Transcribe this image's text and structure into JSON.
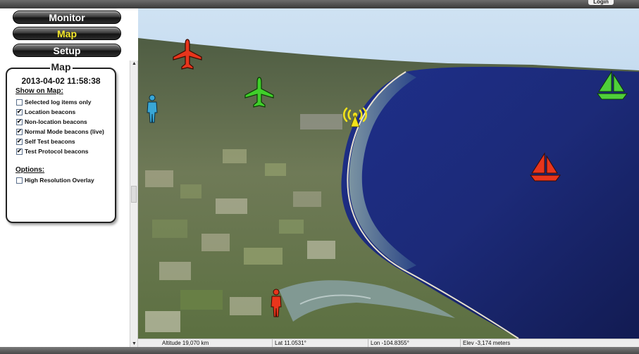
{
  "header": {
    "login_label": "Login"
  },
  "nav": {
    "monitor": "Monitor",
    "map": "Map",
    "setup": "Setup"
  },
  "panel": {
    "title": "Map",
    "datetime": "2013-04-02 11:58:38",
    "show_on_map_label": "Show on Map:",
    "show_items": [
      {
        "label": "Selected log items only",
        "checked": false
      },
      {
        "label": "Location beacons",
        "checked": true
      },
      {
        "label": "Non-location beacons",
        "checked": true
      },
      {
        "label": "Normal Mode beacons (live)",
        "checked": true
      },
      {
        "label": "Self Test beacons",
        "checked": true
      },
      {
        "label": "Test Protocol beacons",
        "checked": true
      }
    ],
    "options_label": "Options:",
    "option_items": [
      {
        "label": "High Resolution Overlay",
        "checked": false
      }
    ]
  },
  "map": {
    "markers": [
      {
        "type": "airplane-icon",
        "color": "#e8351c"
      },
      {
        "type": "airplane-icon",
        "color": "#3fcf2a"
      },
      {
        "type": "person-icon",
        "color": "#39a7d6"
      },
      {
        "type": "radio-beacon-icon",
        "color": "#f2e21b"
      },
      {
        "type": "sailboat-icon",
        "color": "#4fd03a"
      },
      {
        "type": "sailboat-icon",
        "color": "#e8351c"
      },
      {
        "type": "person-icon",
        "color": "#e8351c"
      }
    ]
  },
  "status": {
    "altitude": "Altitude  19,070 km",
    "lat": "Lat 11.0531°",
    "lon": "Lon -104.8355°",
    "elev": "Elev  -3,174 meters"
  }
}
